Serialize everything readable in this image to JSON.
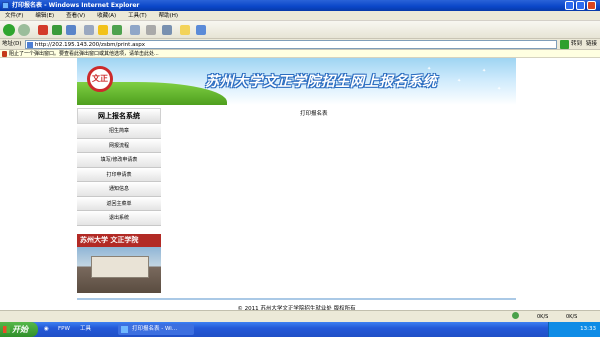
{
  "window": {
    "title": "打印报名表 - Windows Internet Explorer"
  },
  "menu": [
    "文件(F)",
    "编辑(E)",
    "查看(V)",
    "收藏(A)",
    "工具(T)",
    "帮助(H)"
  ],
  "address": {
    "label": "地址(D)",
    "url": "http://202.195.143.200/zsbm/print.aspx",
    "go_label": "转到",
    "links_label": "链接"
  },
  "infobar": {
    "text": "阻止了一个弹出窗口。要查看此弹出窗口或其他选项，请单击此处..."
  },
  "banner": {
    "logo_text": "文正",
    "title": "苏州大学文正学院招生网上报名系统"
  },
  "sidebar": {
    "heading": "网上报名系统",
    "items": [
      "招生简章",
      "网报流程",
      "填写/修改申请表",
      "打印申请表",
      "通知信息",
      "返回主菜单",
      "退出系统"
    ],
    "campus_text": "苏州大学 文正学院"
  },
  "main": {
    "title": "打印报名表"
  },
  "footer": {
    "text": "© 2011 苏州大学文正学院招生就业处 版权所有"
  },
  "statusbar": {
    "zone1": "0K/S",
    "zone2": "0K/S"
  },
  "taskbar": {
    "start_label": "开始",
    "items": [
      "FPW",
      "工具"
    ],
    "active_window": "打印报名表 - Wi...",
    "clock": "13:33"
  }
}
